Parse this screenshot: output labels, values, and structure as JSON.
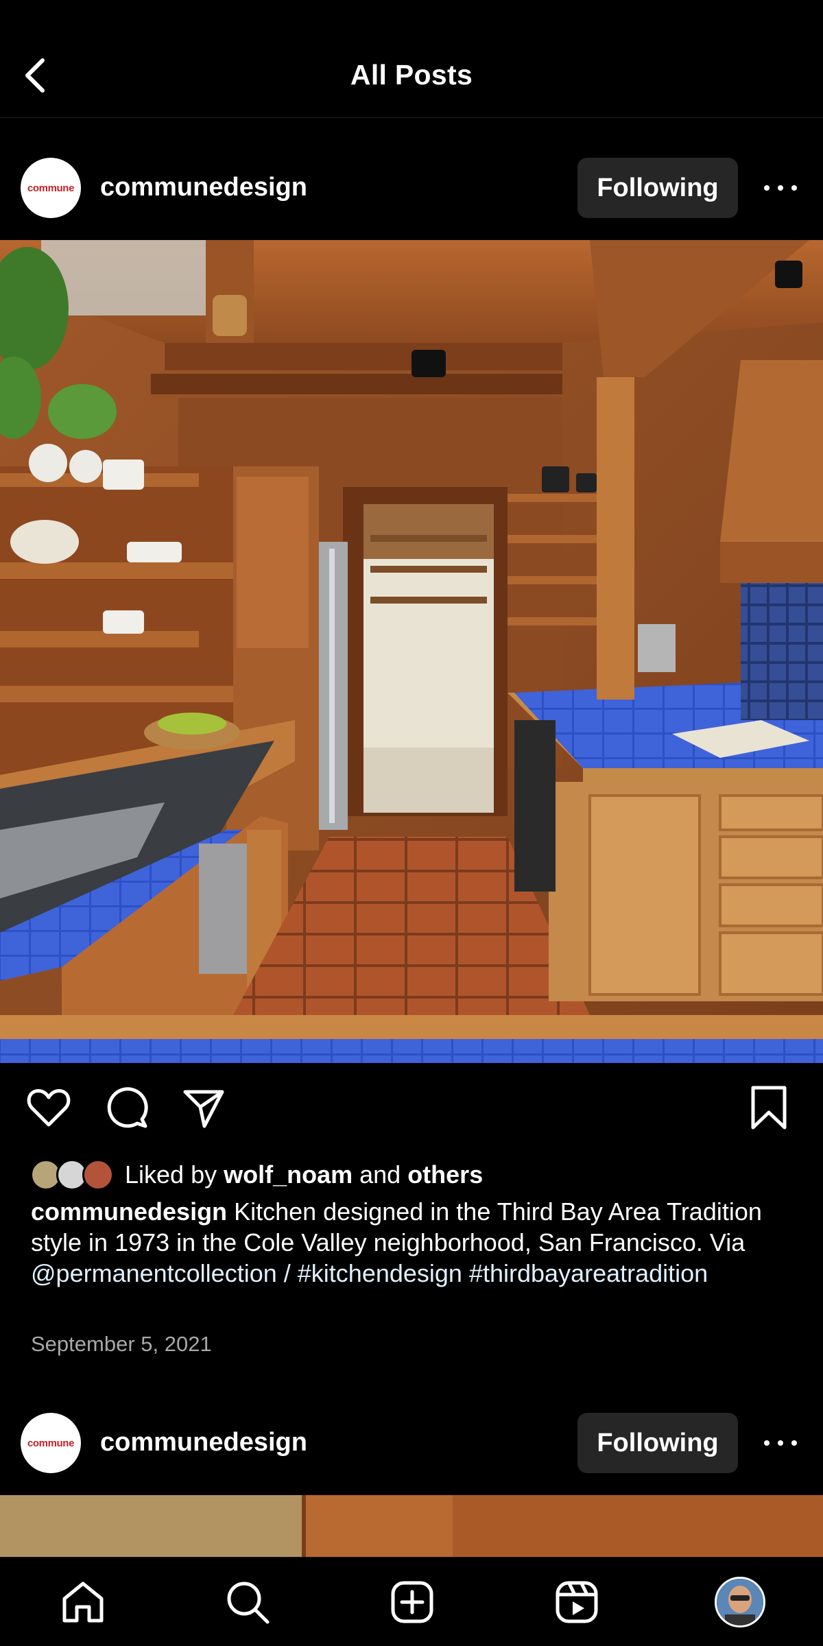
{
  "header": {
    "title": "All Posts",
    "back_icon": "chevron-left-icon"
  },
  "posts": [
    {
      "avatar_text": "commune",
      "username": "communedesign",
      "follow_label": "Following",
      "more_icon": "more-horizontal-icon",
      "image": "kitchen-photo",
      "actions": [
        "heart-icon",
        "comment-icon",
        "share-icon",
        "bookmark-icon"
      ],
      "likes": {
        "prefix": "Liked by",
        "user": "wolf_noam",
        "and": "and",
        "others": "others"
      },
      "caption": {
        "user": "communedesign",
        "text": "Kitchen designed in the Third Bay Area Tradition style in 1973 in the Cole Valley neighborhood, San Francisco. Via",
        "mention": "@permanentcollection",
        "separator": "/",
        "tag1": "#kitchendesign",
        "tag2": "#thirdbayareatradition"
      },
      "date": "September 5, 2021"
    },
    {
      "avatar_text": "commune",
      "username": "communedesign",
      "follow_label": "Following",
      "more_icon": "more-horizontal-icon"
    }
  ],
  "tabbar": [
    "home-icon",
    "search-icon",
    "new-post-icon",
    "reels-icon",
    "profile-avatar"
  ],
  "colors": {
    "background": "#000000",
    "button": "#262626",
    "link": "#e0f1ff",
    "secondary_text": "#a8a8a8",
    "brand_red": "#c3242a"
  }
}
